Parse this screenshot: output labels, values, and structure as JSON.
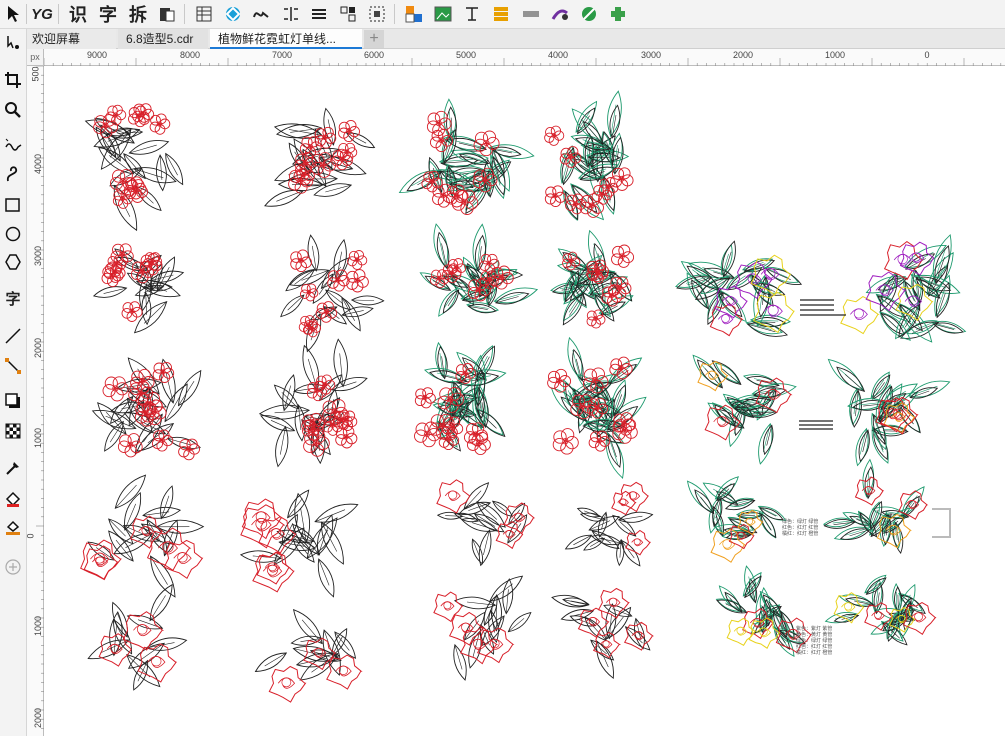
{
  "toolbar": {
    "logo_text": "YG",
    "btn_shi": "识",
    "btn_zi": "字",
    "btn_chai": "拆"
  },
  "tabs": {
    "home_label": "欢迎屏幕",
    "doc1_label": "6.8造型5.cdr",
    "doc2_label": "植物鲜花霓虹灯单线...",
    "add_label": "+"
  },
  "toolbox": {
    "text_tool_label": "字"
  },
  "ruler": {
    "corner_label": "px",
    "h_labels": [
      "9000",
      "8000",
      "7000",
      "6000",
      "5000",
      "4000",
      "3000",
      "2000",
      "1000",
      "0"
    ],
    "v_labels": [
      "500",
      "4000",
      "3000",
      "2000",
      "1000",
      "0",
      "1000",
      "2000"
    ]
  },
  "canvas": {
    "legend_right_top": "绿色：绿灯 绿管\n红色：红灯 红管\n橘红：红灯 橙管",
    "legend_right_bottom": "紫色：紫灯 紫管\n黄色：黄灯 黄管\n绿色：绿灯 绿管\n红色：红灯 红管\n橘红：红灯 橙管"
  },
  "colors": {
    "accent": "#1d7ad6",
    "red_line": "#d8202a",
    "green_line": "#1e9a6e",
    "yellow_line": "#e8d21c",
    "orange_line": "#f0a020",
    "purple_line": "#a020c0",
    "black_line": "#222222"
  }
}
